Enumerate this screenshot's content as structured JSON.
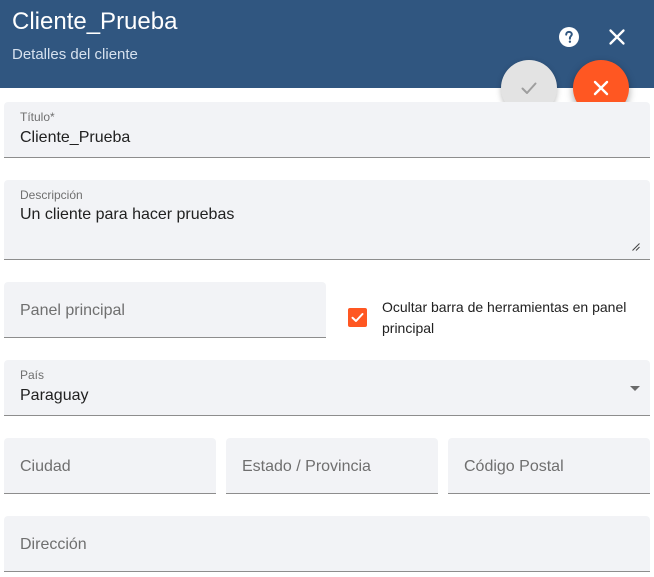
{
  "header": {
    "title": "Cliente_Prueba",
    "subtitle": "Detalles del cliente",
    "background_color": "#305680",
    "help_icon": "help-circle-icon",
    "close_icon": "close-icon"
  },
  "actions": {
    "confirm_icon": "check-icon",
    "cancel_icon": "close-icon",
    "cancel_color": "#ff5722",
    "confirm_color": "#e3e3e3"
  },
  "form": {
    "title_field": {
      "label": "Título*",
      "value": "Cliente_Prueba"
    },
    "description_field": {
      "label": "Descripción",
      "value": "Un cliente para hacer pruebas"
    },
    "dashboard_field": {
      "placeholder": "Panel principal"
    },
    "hide_toolbar_checkbox": {
      "label": "Ocultar barra de herramientas en panel principal",
      "checked": true
    },
    "country_field": {
      "label": "País",
      "value": "Paraguay"
    },
    "city_field": {
      "placeholder": "Ciudad"
    },
    "state_field": {
      "placeholder": "Estado / Provincia"
    },
    "zip_field": {
      "placeholder": "Código Postal"
    },
    "address_field": {
      "placeholder": "Dirección"
    }
  }
}
